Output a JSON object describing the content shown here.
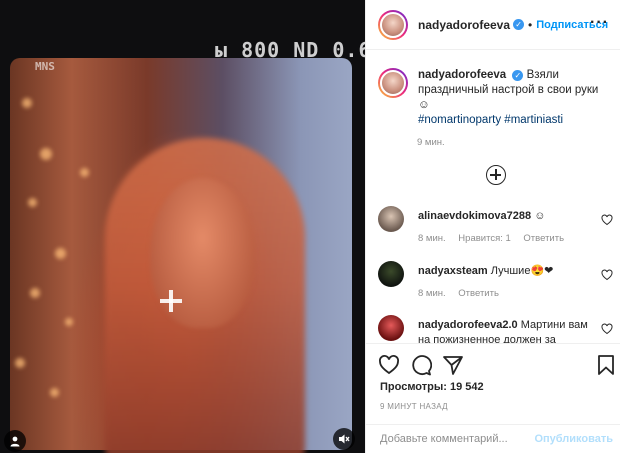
{
  "media": {
    "overlay_text_top": "ы 800  ND 0.6",
    "overlay_text_left": "MNS",
    "icons": [
      "user-tag-icon",
      "mute-icon",
      "crosshair-icon"
    ]
  },
  "header": {
    "username": "nadyadorofeeva",
    "separator": "•",
    "follow_label": "Подписаться",
    "more_label": "···"
  },
  "caption": {
    "username": "nadyadorofeeva",
    "text": "Взяли праздничный настрой в свои руки ☺",
    "hashtags": "#nomartinoparty #martiniasti",
    "time": "9 мин."
  },
  "comments": [
    {
      "username": "alinaevdokimova7288",
      "text": "☺",
      "time": "8 мин.",
      "likes": "Нравится: 1",
      "reply": "Ответить"
    },
    {
      "username": "nadyaxsteam",
      "text": "Лучшие😍❤",
      "time": "8 мин.",
      "reply": "Ответить"
    },
    {
      "username": "nadyadorofeeva2.0",
      "text": "Мартини вам на пожизненное должен за",
      "time": "",
      "reply": ""
    }
  ],
  "actions": {
    "icons": [
      "heart-icon",
      "comment-icon",
      "share-icon",
      "bookmark-icon"
    ],
    "views_label": "Просмотры: 19 542",
    "posted": "9 МИНУТ НАЗАД"
  },
  "comment_box": {
    "placeholder": "Добавьте комментарий...",
    "publish_label": "Опубликовать"
  },
  "colors": {
    "link_blue": "#0095f6",
    "publish_disabled": "#b2dffc",
    "verified_blue": "#3897f0",
    "hashtag": "#00376b",
    "muted": "#8e8e8e"
  }
}
